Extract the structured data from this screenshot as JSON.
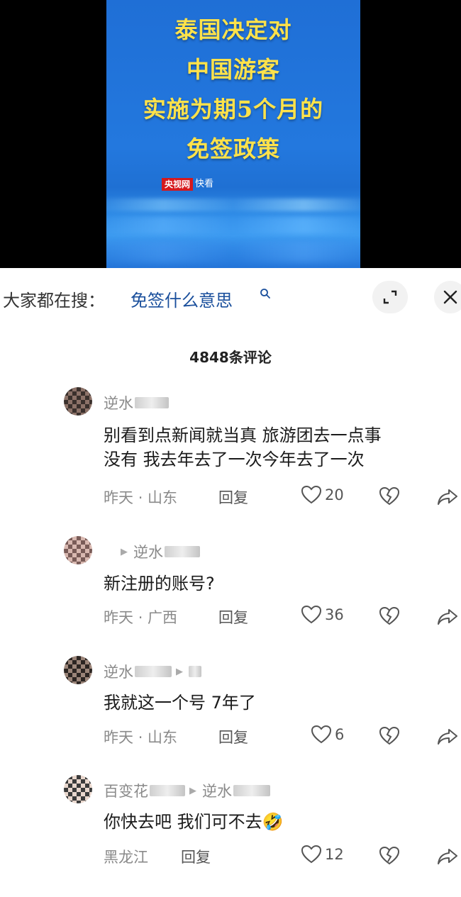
{
  "video": {
    "title_lines": [
      "泰国决定对",
      "中国游客",
      "实施为期5个月的",
      "免签政策"
    ],
    "brand_logo": "央视网",
    "brand_text": "快看"
  },
  "search": {
    "label": "大家都在搜：",
    "term": "免签什么意思"
  },
  "comment_count": "4848条评论",
  "comments": [
    {
      "author": "逆水",
      "reply_to": "",
      "text": [
        "别看到点新闻就当真 旅游团去一点事",
        "没有 我去年去了一次今年去了一次"
      ],
      "date": "昨天",
      "location": "山东",
      "reply_label": "回复",
      "likes": "20"
    },
    {
      "author": "",
      "reply_to": "逆水",
      "text": [
        "新注册的账号?"
      ],
      "date": "昨天",
      "location": "广西",
      "reply_label": "回复",
      "likes": "36"
    },
    {
      "author": "逆水",
      "reply_to": "",
      "text": [
        "我就这一个号 7年了"
      ],
      "date": "昨天",
      "location": "山东",
      "reply_label": "回复",
      "likes": "6"
    },
    {
      "author": "百变花",
      "reply_to": "逆水",
      "text": [
        "你快去吧  我们可不去🤣"
      ],
      "date": "",
      "location": "黑龙江",
      "reply_label": "回复",
      "likes": "12"
    }
  ],
  "icons": {
    "search": "search-icon",
    "expand": "expand-icon",
    "close": "close-icon",
    "like": "heart-icon",
    "dislike": "broken-heart-icon",
    "share": "share-arrow-icon"
  },
  "colors": {
    "accent_link": "#1a4f9c",
    "video_title": "#ffe24a",
    "video_bg": "#2378de",
    "brand_red": "#d5191d"
  }
}
